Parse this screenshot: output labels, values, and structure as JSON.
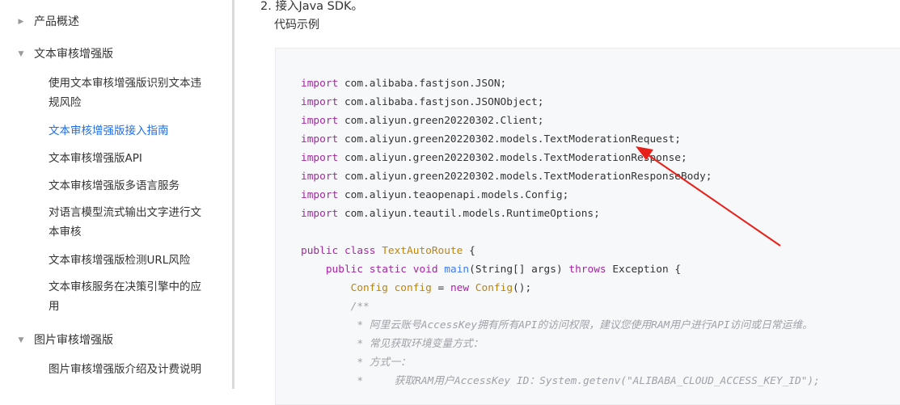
{
  "sidebar": {
    "sections": [
      {
        "label": "产品概述",
        "arrow": "▶",
        "items": []
      },
      {
        "label": "文本审核增强版",
        "arrow": "▼",
        "items": [
          {
            "lines": [
              "使用文本审核增强版识别文本违",
              "规风险"
            ],
            "active": false
          },
          {
            "lines": [
              "文本审核增强版接入指南"
            ],
            "active": true
          },
          {
            "lines": [
              "文本审核增强版API"
            ],
            "active": false
          },
          {
            "lines": [
              "文本审核增强版多语言服务"
            ],
            "active": false
          },
          {
            "lines": [
              "对语言模型流式输出文字进行文",
              "本审核"
            ],
            "active": false
          },
          {
            "lines": [
              "文本审核增强版检测URL风险"
            ],
            "active": false
          },
          {
            "lines": [
              "文本审核服务在决策引擎中的应",
              "用"
            ],
            "active": false
          }
        ]
      },
      {
        "label": "图片审核增强版",
        "arrow": "▼",
        "items": [
          {
            "lines": [
              "图片审核增强版介绍及计费说明"
            ],
            "active": false
          }
        ]
      }
    ]
  },
  "content": {
    "step_title": "2. 接入Java SDK。",
    "step_subtitle": "代码示例",
    "code_lines": [
      [
        [
          "kw",
          "import"
        ],
        [
          "t",
          " com.alibaba.fastjson.JSON;"
        ]
      ],
      [
        [
          "kw",
          "import"
        ],
        [
          "t",
          " com.alibaba.fastjson.JSONObject;"
        ]
      ],
      [
        [
          "kw",
          "import"
        ],
        [
          "t",
          " com.aliyun.green20220302.Client;"
        ]
      ],
      [
        [
          "kw",
          "import"
        ],
        [
          "t",
          " com.aliyun.green20220302.models.TextModerationRequest;"
        ]
      ],
      [
        [
          "kw",
          "import"
        ],
        [
          "t",
          " com.aliyun.green20220302.models.TextModerationResponse;"
        ]
      ],
      [
        [
          "kw",
          "import"
        ],
        [
          "t",
          " com.aliyun.green20220302.models.TextModerationResponseBody;"
        ]
      ],
      [
        [
          "kw",
          "import"
        ],
        [
          "t",
          " com.aliyun.teaopenapi.models.Config;"
        ]
      ],
      [
        [
          "kw",
          "import"
        ],
        [
          "t",
          " com.aliyun.teautil.models.RuntimeOptions;"
        ]
      ],
      [],
      [
        [
          "kw",
          "public"
        ],
        [
          "t",
          " "
        ],
        [
          "kw",
          "class"
        ],
        [
          "t",
          " "
        ],
        [
          "cls",
          "TextAutoRoute"
        ],
        [
          "t",
          " {"
        ]
      ],
      [
        [
          "t",
          "    "
        ],
        [
          "kw",
          "public"
        ],
        [
          "t",
          " "
        ],
        [
          "kw",
          "static"
        ],
        [
          "t",
          " "
        ],
        [
          "kw",
          "void"
        ],
        [
          "t",
          " "
        ],
        [
          "fn",
          "main"
        ],
        [
          "t",
          "(String[] args) "
        ],
        [
          "kw",
          "throws"
        ],
        [
          "t",
          " Exception {"
        ]
      ],
      [
        [
          "t",
          "        "
        ],
        [
          "cls",
          "Config"
        ],
        [
          "t",
          " "
        ],
        [
          "cls",
          "config"
        ],
        [
          "t",
          " = "
        ],
        [
          "kw",
          "new"
        ],
        [
          "t",
          " "
        ],
        [
          "cls",
          "Config"
        ],
        [
          "t",
          "();"
        ]
      ],
      [
        [
          "t",
          "        "
        ],
        [
          "cmt",
          "/**"
        ]
      ],
      [
        [
          "t",
          "         "
        ],
        [
          "cmt",
          "* 阿里云账号AccessKey拥有所有API的访问权限，建议您使用RAM用户进行API访问或日常运维。"
        ]
      ],
      [
        [
          "t",
          "         "
        ],
        [
          "cmt",
          "* 常见获取环境变量方式："
        ]
      ],
      [
        [
          "t",
          "         "
        ],
        [
          "cmt",
          "* 方式一："
        ]
      ],
      [
        [
          "t",
          "         "
        ],
        [
          "cmt",
          "*     获取RAM用户AccessKey ID：System.getenv(\"ALIBABA_CLOUD_ACCESS_KEY_ID\");"
        ]
      ]
    ]
  },
  "colors": {
    "active_link": "#1f6feb",
    "keyword": "#a626a4",
    "class_name": "#c18401",
    "function": "#4078f2",
    "comment": "#a0a1a7",
    "annotation_arrow": "#e8201a"
  }
}
